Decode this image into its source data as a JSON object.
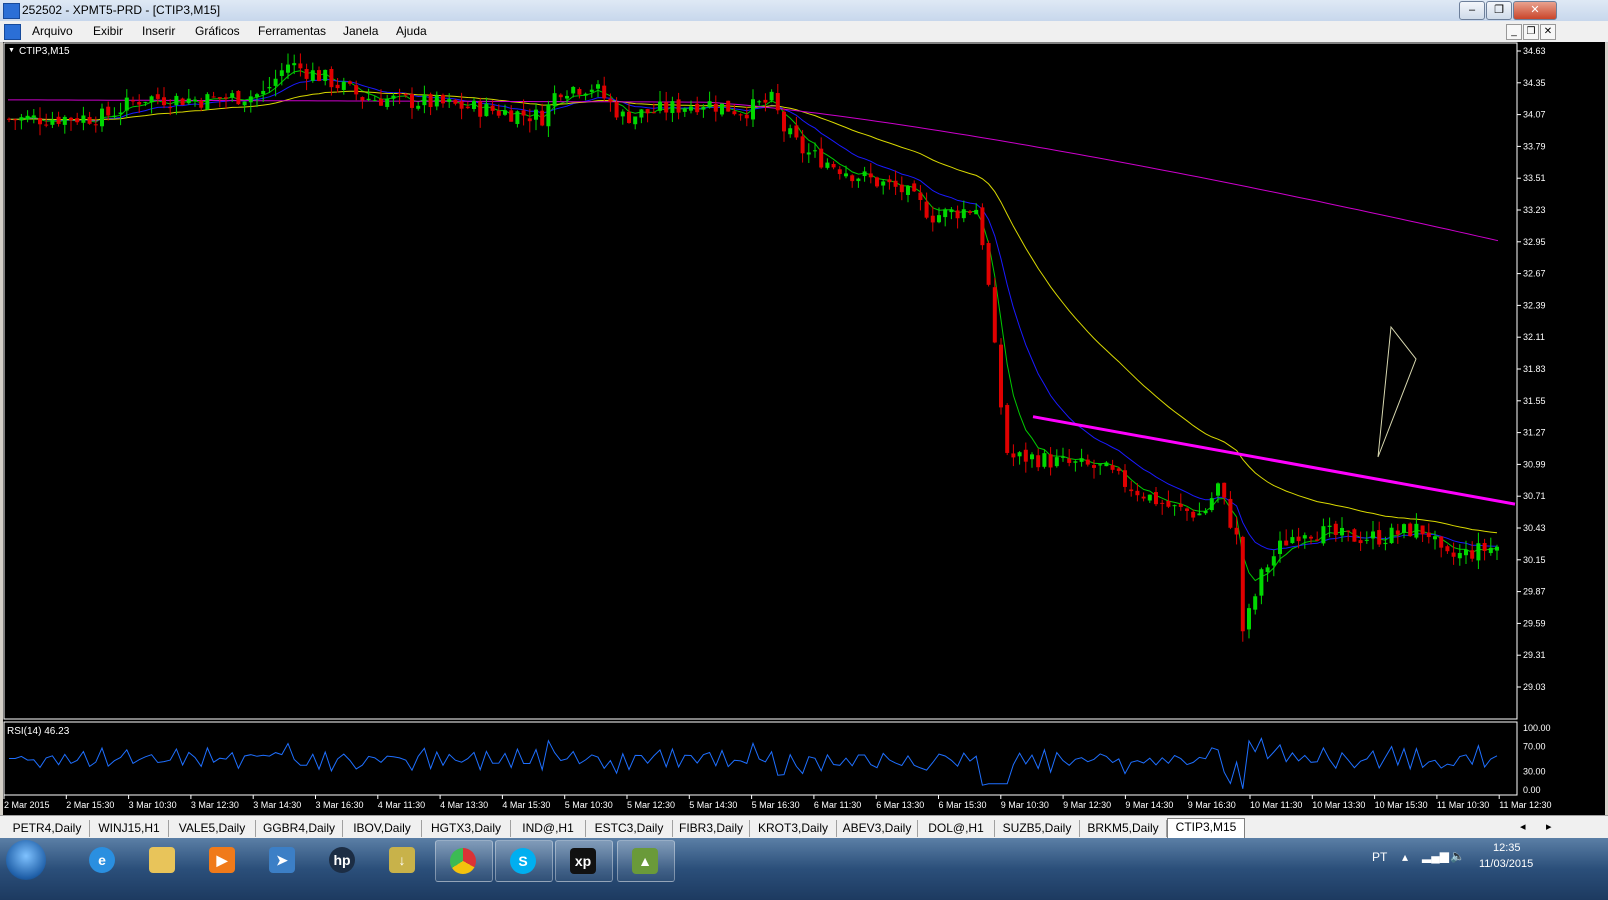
{
  "window": {
    "title": "252502 - XPMT5-PRD - [CTIP3,M15]"
  },
  "menu": [
    "Arquivo",
    "Exibir",
    "Inserir",
    "Gráficos",
    "Ferramentas",
    "Janela",
    "Ajuda"
  ],
  "chart": {
    "label": "CTIP3,M15",
    "price_levels": [
      "34.63",
      "34.35",
      "34.07",
      "33.79",
      "33.51",
      "33.23",
      "32.95",
      "32.67",
      "32.39",
      "32.11",
      "31.83",
      "31.55",
      "31.27",
      "30.99",
      "30.71",
      "30.43",
      "30.15",
      "29.87",
      "29.59",
      "29.31",
      "29.03"
    ],
    "time_labels": [
      "2 Mar 2015",
      "2 Mar 15:30",
      "3 Mar 10:30",
      "3 Mar 12:30",
      "3 Mar 14:30",
      "3 Mar 16:30",
      "4 Mar 11:30",
      "4 Mar 13:30",
      "4 Mar 15:30",
      "5 Mar 10:30",
      "5 Mar 12:30",
      "5 Mar 14:30",
      "5 Mar 16:30",
      "6 Mar 11:30",
      "6 Mar 13:30",
      "6 Mar 15:30",
      "9 Mar 10:30",
      "9 Mar 12:30",
      "9 Mar 14:30",
      "9 Mar 16:30",
      "10 Mar 11:30",
      "10 Mar 13:30",
      "10 Mar 15:30",
      "11 Mar 10:30",
      "11 Mar 12:30"
    ],
    "colors": {
      "bull": "#00d800",
      "bear": "#e00000",
      "trendline": "#ff00ff",
      "ma_fast": "#00c800",
      "ma_mid": "#1a1aff",
      "ma_slow": "#d8d800",
      "ma_long": "#cc00cc",
      "rsi": "#1e6fff"
    },
    "rsi_label": "RSI(14) 46.23",
    "rsi_levels": [
      "100.00",
      "70.00",
      "30.00",
      "0.00"
    ]
  },
  "tabs": [
    "PETR4,Daily",
    "WINJ15,H1",
    "VALE5,Daily",
    "GGBR4,Daily",
    "IBOV,Daily",
    "HGTX3,Daily",
    "IND@,H1",
    "ESTC3,Daily",
    "FIBR3,Daily",
    "KROT3,Daily",
    "ABEV3,Daily",
    "DOL@,H1",
    "SUZB5,Daily",
    "BRKM5,Daily",
    "CTIP3,M15"
  ],
  "active_tab": "CTIP3,M15",
  "tray": {
    "language": "PT",
    "time": "12:35",
    "date": "11/03/2015"
  },
  "taskbar_apps": [
    "start-orb",
    "internet-explorer-icon",
    "windows-explorer-icon",
    "media-player-icon",
    "app-arrow-icon",
    "hp-icon",
    "app-folder-icon",
    "chrome-icon",
    "skype-icon",
    "xp-icon",
    "metatrader-icon"
  ]
}
